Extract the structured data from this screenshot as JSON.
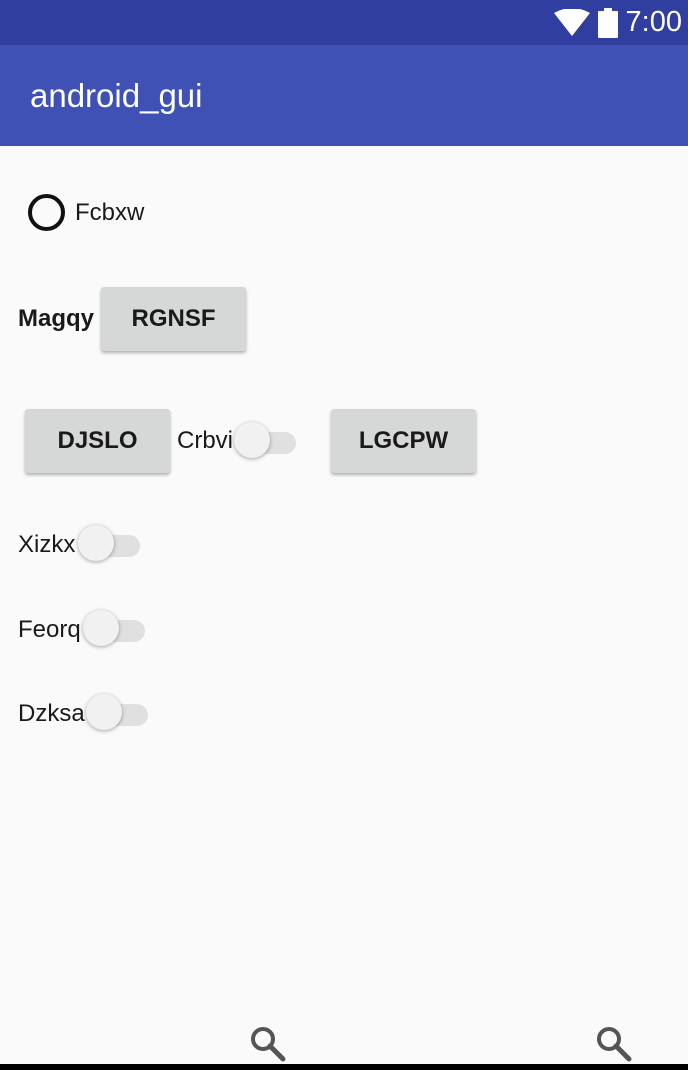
{
  "status_bar": {
    "time": "7:00",
    "wifi_icon": "wifi-icon",
    "battery_icon": "battery-icon"
  },
  "app_bar": {
    "title": "android_gui",
    "background": "#3f51b5",
    "status_background": "#303f9f"
  },
  "content": {
    "radio": {
      "label": "Fcbxw",
      "checked": false
    },
    "row2": {
      "label": "Magqy",
      "button": "RGNSF"
    },
    "row3": {
      "button_left": "DJSLO",
      "switch_label": "Crbvi",
      "switch_on": false,
      "button_right": "LGCPW"
    },
    "switches": [
      {
        "label": "Xizkx",
        "on": false
      },
      {
        "label": "Feorq",
        "on": false
      },
      {
        "label": "Dzksa",
        "on": false
      }
    ]
  },
  "bottom_icons": [
    "search-icon",
    "search-icon"
  ]
}
